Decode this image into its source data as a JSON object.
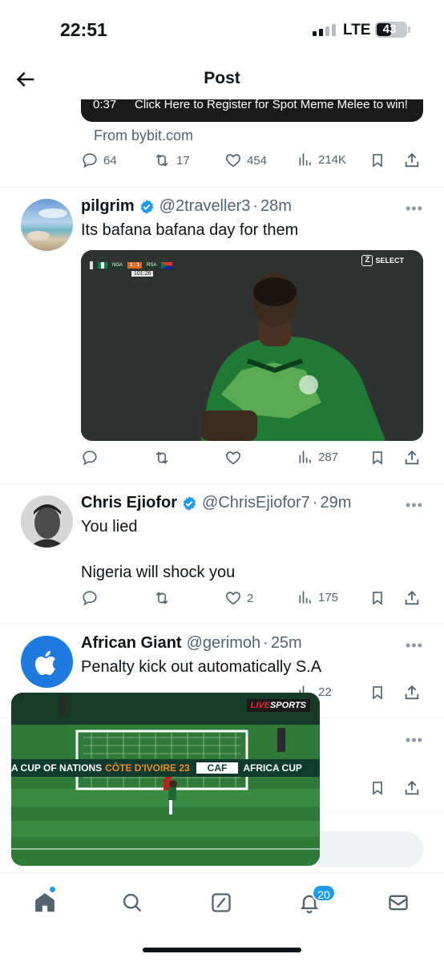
{
  "status_bar": {
    "time": "22:51",
    "network": "LTE",
    "battery": "43"
  },
  "header": {
    "title": "Post"
  },
  "ad": {
    "video_time": "0:37",
    "video_caption": "Click Here to Register for Spot Meme Melee to win!",
    "from": "From bybit.com",
    "stats": {
      "replies": "64",
      "reposts": "17",
      "likes": "454",
      "views": "214K"
    }
  },
  "tweets": [
    {
      "name": "pilgrim",
      "handle": "@2traveller3",
      "time": "28m",
      "text": "Its bafana bafana day for them",
      "media": {
        "home": "NGA",
        "score": "1 : 1",
        "away": "RSA",
        "clock": "101:26",
        "broadcaster": "SELECT",
        "broadcaster_sub": "LIVE"
      },
      "stats": {
        "views": "287"
      }
    },
    {
      "name": "Chris Ejiofor",
      "handle": "@ChrisEjiofor7",
      "time": "29m",
      "text_line1": "You lied",
      "text_line2": "Nigeria will shock you",
      "stats": {
        "likes": "2",
        "views": "175"
      }
    },
    {
      "name": "African Giant",
      "handle": "@gerimoh",
      "time": "25m",
      "text": "Penalty kick out automatically S.A",
      "stats": {
        "views": "22"
      }
    },
    {
      "stats": {
        "views": "18"
      }
    }
  ],
  "pip_video": {
    "banner_left": "A CUP OF NATIONS",
    "banner_orange": "CÔTE D'IVOIRE 23",
    "banner_mid": "CAF",
    "banner_right": "AFRICA CUP",
    "logo_live": "LIVE",
    "logo_sports": "SPORTS"
  },
  "tabbar": {
    "notifications_count": "20"
  },
  "colors": {
    "accent": "#1d9bf0",
    "text": "#0f1419",
    "muted": "#536471"
  }
}
